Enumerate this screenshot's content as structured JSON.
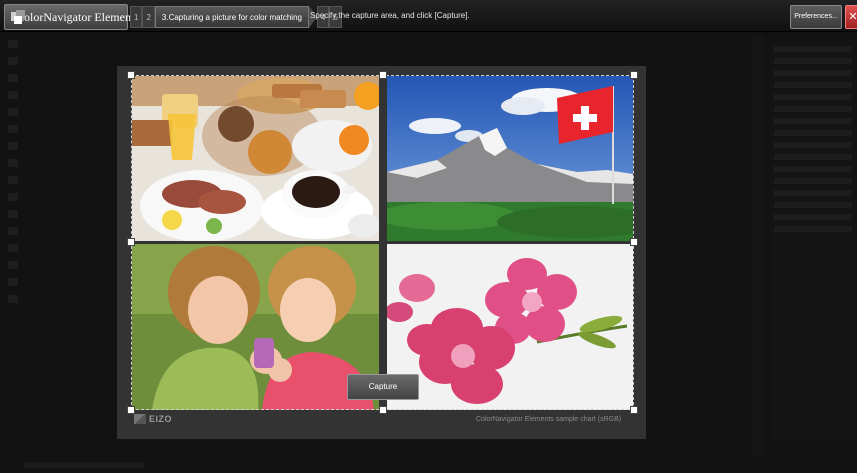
{
  "app": {
    "title": "ColorNavigator Elements"
  },
  "steps": {
    "prev_nums": [
      "1",
      "2"
    ],
    "active_label": "3.Capturing a picture for color matching",
    "next_nums": [
      "4",
      "5"
    ]
  },
  "instruction": "Specify the capture area, and click [Capture].",
  "toolbar": {
    "preferences_label": "Preferences...",
    "close_glyph": "✕"
  },
  "chart": {
    "brand": "EIZO",
    "caption": "ColorNavigator Elements sample chart (sRGB)",
    "capture_label": "Capture"
  },
  "colors": {
    "accent_close": "#c0392b",
    "selection": "#ffffff"
  }
}
